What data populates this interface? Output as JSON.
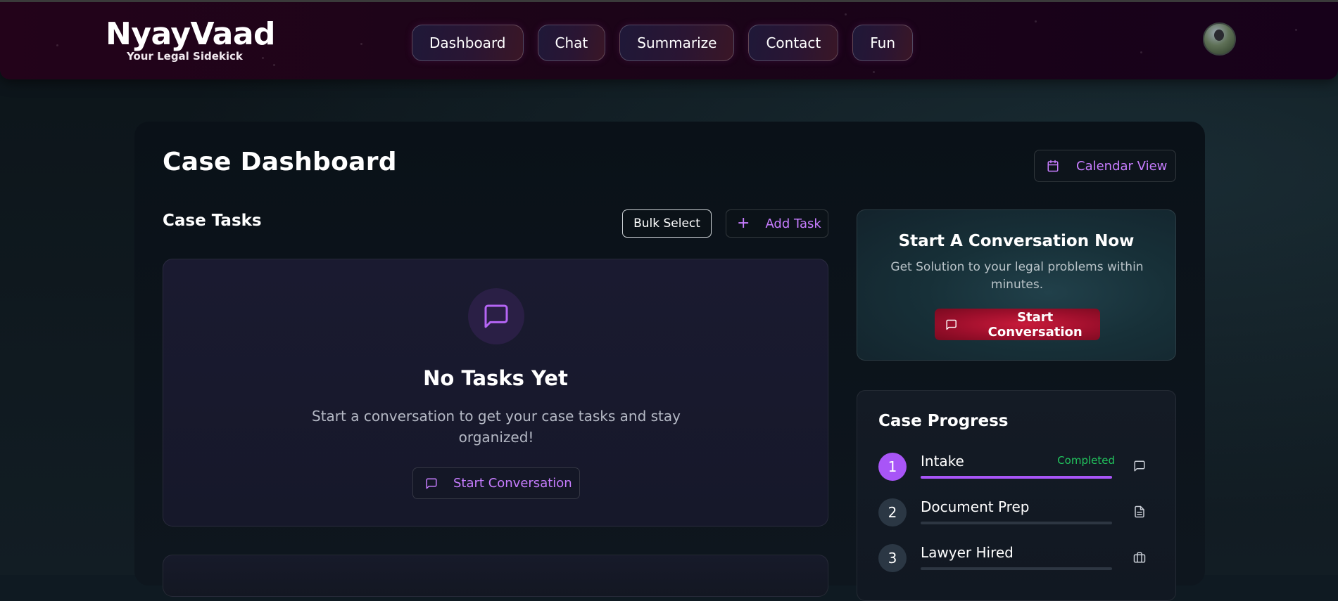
{
  "app": {
    "name": "NyayVaad",
    "tagline": "Your Legal Sidekick"
  },
  "nav": {
    "items": [
      {
        "label": "Dashboard"
      },
      {
        "label": "Chat"
      },
      {
        "label": "Summarize"
      },
      {
        "label": "Contact"
      },
      {
        "label": "Fun"
      }
    ]
  },
  "page": {
    "title": "Case Dashboard",
    "calendar_button": "Calendar View"
  },
  "tasks": {
    "title": "Case Tasks",
    "bulk_select": "Bulk Select",
    "add_task": "Add Task",
    "empty_title": "No Tasks Yet",
    "empty_text": "Start a conversation to get your case tasks and stay organized!",
    "empty_button": "Start Conversation"
  },
  "promo": {
    "title": "Start A Conversation Now",
    "text": "Get Solution to your legal problems within minutes.",
    "button": "Start Conversation"
  },
  "progress": {
    "title": "Case Progress",
    "steps": [
      {
        "number": "1",
        "name": "Intake",
        "status": "Completed",
        "percent": 100,
        "icon": "chat-icon"
      },
      {
        "number": "2",
        "name": "Document Prep",
        "status": "",
        "percent": 0,
        "icon": "document-icon"
      },
      {
        "number": "3",
        "name": "Lawyer Hired",
        "status": "",
        "percent": 0,
        "icon": "briefcase-icon"
      }
    ]
  },
  "colors": {
    "accent": "#c77dff",
    "step_active": "#a855f7",
    "completed": "#22c55e",
    "promo_button": "#b3122f"
  }
}
